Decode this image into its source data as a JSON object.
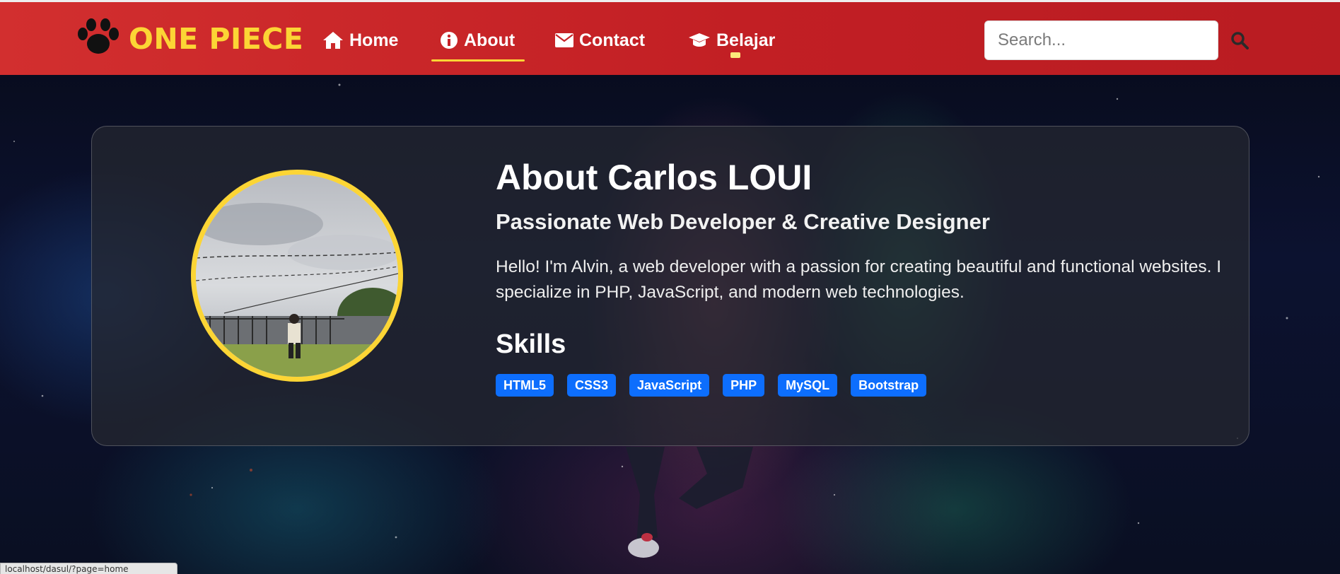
{
  "brand": {
    "name": "ONE PIECE",
    "icon": "paw-icon"
  },
  "nav": {
    "items": [
      {
        "label": "Home",
        "icon": "home-icon"
      },
      {
        "label": "About",
        "icon": "info-circle-icon",
        "active": true
      },
      {
        "label": "Contact",
        "icon": "envelope-icon"
      },
      {
        "label": "Belajar",
        "icon": "graduation-cap-icon"
      }
    ]
  },
  "search": {
    "placeholder": "Search...",
    "value": "",
    "icon": "search-icon"
  },
  "about": {
    "title": "About Carlos LOUI",
    "subtitle": "Passionate Web Developer & Creative Designer",
    "bio": "Hello! I'm Alvin, a web developer with a passion for creating beautiful and functional websites. I specialize in PHP, JavaScript, and modern web technologies.",
    "skills_title": "Skills",
    "skills": [
      "HTML5",
      "CSS3",
      "JavaScript",
      "PHP",
      "MySQL",
      "Bootstrap"
    ]
  },
  "status_bar": {
    "url": "localhost/dasul/?page=home"
  },
  "colors": {
    "navbar": "#c62228",
    "brand": "#fcd535",
    "accent": "#fcd535",
    "badge": "#0d6efd",
    "card": "#26282f"
  }
}
